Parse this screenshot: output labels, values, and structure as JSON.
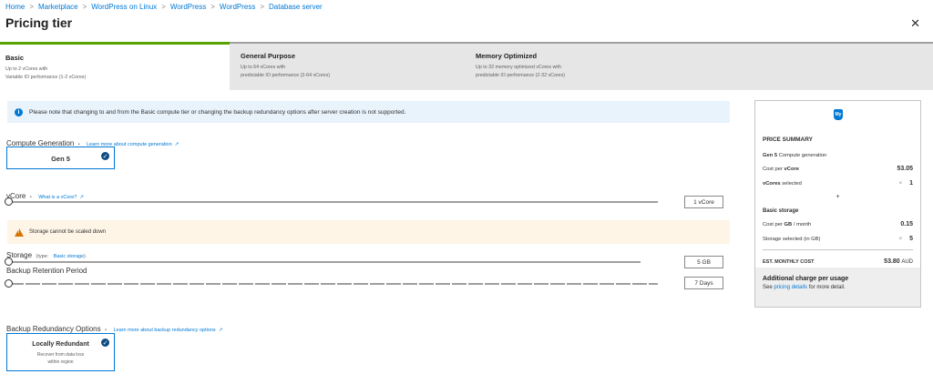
{
  "breadcrumb": [
    "Home",
    "Marketplace",
    "WordPress on Linux",
    "WordPress",
    "WordPress",
    "Database server"
  ],
  "title": "Pricing tier",
  "tiers": [
    {
      "name": "Basic",
      "desc1": "Up to 2 vCores with",
      "desc2": "Variable IO performance (1-2 vCores)"
    },
    {
      "name": "General Purpose",
      "desc1": "Up to 64 vCores with",
      "desc2": "predictable IO performance (2-64 vCores)"
    },
    {
      "name": "Memory Optimized",
      "desc1": "Up to 32 memory optimized vCores with",
      "desc2": "predictable IO performance (2-32 vCores)"
    }
  ],
  "info_text": "Please note that changing to and from the Basic compute tier or changing the backup redundancy options after server creation is not supported.",
  "compute": {
    "label": "Compute Generation",
    "link": "Learn more about compute generation",
    "option": "Gen 5"
  },
  "vcore": {
    "label": "vCore",
    "link": "What is a vCore?",
    "value": "1 vCore",
    "position": 0
  },
  "warning_text": "Storage cannot be scaled down",
  "storage": {
    "label": "Storage",
    "type_prefix": "(type:",
    "type_link": "Basic storage",
    "type_suffix": ")",
    "value": "5 GB",
    "position": 0
  },
  "backup_retention": {
    "label": "Backup Retention Period",
    "value": "7 Days",
    "position": 0
  },
  "redundancy": {
    "label": "Backup Redundancy Options",
    "link": "Learn more about backup redundancy options",
    "option": "Locally Redundant",
    "desc1": "Recover from data loss",
    "desc2": "within region"
  },
  "summary": {
    "icon": "My",
    "title": "PRICE SUMMARY",
    "gen_bold": "Gen 5",
    "gen_rest": "Compute generation",
    "cost_vcore_label": "Cost per",
    "cost_vcore_bold": "vCore",
    "cost_vcore_value": "53.05",
    "vcores_label": "vCores",
    "vcores_rest": "selected",
    "times": "×",
    "vcores_value": "1",
    "plus": "+",
    "storage_title": "Basic storage",
    "cost_gb_label": "Cost per",
    "cost_gb_bold": "GB",
    "cost_gb_rest": "/ month",
    "cost_gb_value": "0.15",
    "storage_sel_label": "Storage selected (in GB)",
    "storage_sel_value": "5",
    "est_label": "EST. MONTHLY COST",
    "est_value": "53.80",
    "currency": "AUD",
    "extra_title": "Additional charge per usage",
    "extra_prefix": "See",
    "extra_link": "pricing details",
    "extra_suffix": "for more detail."
  },
  "colors": {
    "accent": "#0078d4",
    "active_tier": "#57a300",
    "warning": "#d47500"
  }
}
